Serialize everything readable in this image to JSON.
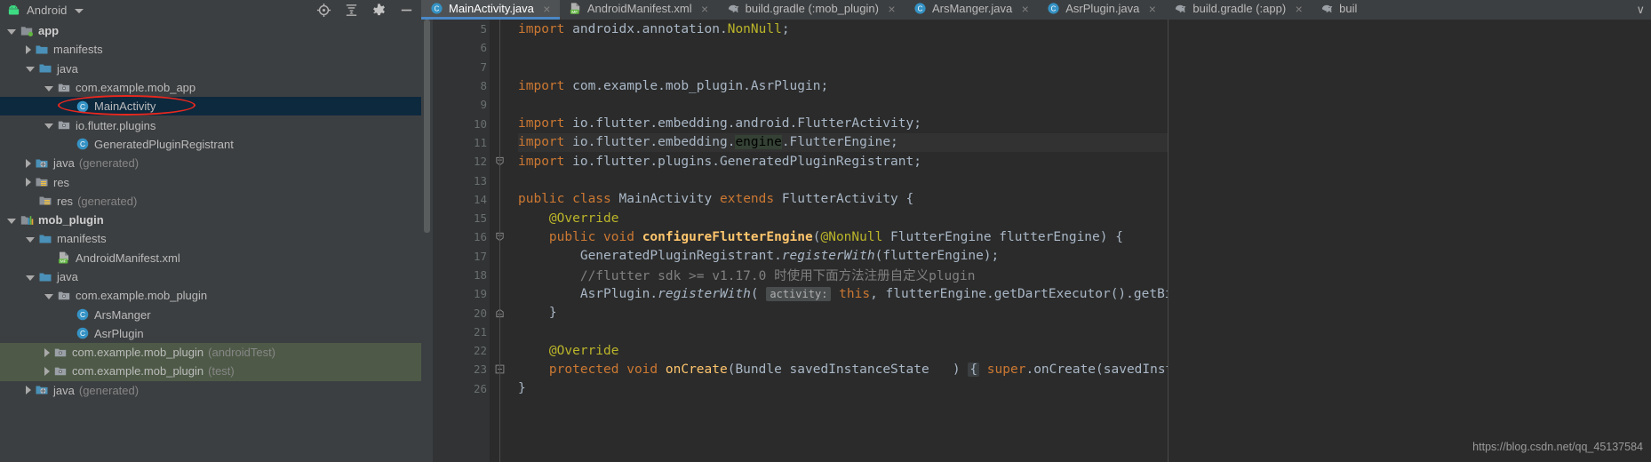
{
  "window": {
    "project_panel_title": "Android",
    "panel_icons": [
      "target-icon",
      "collapse-all-icon",
      "settings-gear-icon",
      "minimize-icon"
    ]
  },
  "tabs": {
    "overflow_label": "∨",
    "items": [
      {
        "label": "MainActivity.java",
        "icon": "java-class-icon",
        "active": true,
        "close": "×"
      },
      {
        "label": "AndroidManifest.xml",
        "icon": "manifest-xml-icon",
        "active": false,
        "close": "×"
      },
      {
        "label": "build.gradle (:mob_plugin)",
        "icon": "gradle-elephant-icon",
        "active": false,
        "close": "×"
      },
      {
        "label": "ArsManger.java",
        "icon": "java-class-icon",
        "active": false,
        "close": "×"
      },
      {
        "label": "AsrPlugin.java",
        "icon": "java-class-icon",
        "active": false,
        "close": "×"
      },
      {
        "label": "build.gradle (:app)",
        "icon": "gradle-elephant-icon",
        "active": false,
        "close": "×"
      },
      {
        "label": "buil",
        "icon": "gradle-elephant-icon",
        "active": false,
        "close": ""
      }
    ]
  },
  "project_tree": {
    "rows": [
      {
        "indent": 0,
        "arrow": "down",
        "icon": "module-app-icon",
        "label": "app",
        "suffix": "",
        "bold": true,
        "state": "normal"
      },
      {
        "indent": 1,
        "arrow": "right",
        "icon": "folder-icon",
        "label": "manifests",
        "suffix": "",
        "bold": false,
        "state": "normal"
      },
      {
        "indent": 1,
        "arrow": "down",
        "icon": "folder-icon",
        "label": "java",
        "suffix": "",
        "bold": false,
        "state": "normal"
      },
      {
        "indent": 2,
        "arrow": "down",
        "icon": "package-icon",
        "label": "com.example.mob_app",
        "suffix": "",
        "bold": false,
        "state": "normal"
      },
      {
        "indent": 3,
        "arrow": "none",
        "icon": "java-class-icon",
        "label": "MainActivity",
        "suffix": "",
        "bold": false,
        "state": "selected"
      },
      {
        "indent": 2,
        "arrow": "down",
        "icon": "package-icon",
        "label": "io.flutter.plugins",
        "suffix": "",
        "bold": false,
        "state": "normal"
      },
      {
        "indent": 3,
        "arrow": "none",
        "icon": "java-class-icon",
        "label": "GeneratedPluginRegistrant",
        "suffix": "",
        "bold": false,
        "state": "normal"
      },
      {
        "indent": 1,
        "arrow": "right",
        "icon": "folder-generated-icon",
        "label": "java",
        "suffix": "(generated)",
        "bold": false,
        "state": "normal"
      },
      {
        "indent": 1,
        "arrow": "right",
        "icon": "res-folder-icon",
        "label": "res",
        "suffix": "",
        "bold": false,
        "state": "normal"
      },
      {
        "indent": 1,
        "arrow": "none",
        "icon": "res-folder-icon",
        "label": "res",
        "suffix": "(generated)",
        "bold": false,
        "state": "normal"
      },
      {
        "indent": 0,
        "arrow": "down",
        "icon": "module-library-icon",
        "label": "mob_plugin",
        "suffix": "",
        "bold": true,
        "state": "normal"
      },
      {
        "indent": 1,
        "arrow": "down",
        "icon": "folder-icon",
        "label": "manifests",
        "suffix": "",
        "bold": false,
        "state": "normal"
      },
      {
        "indent": 2,
        "arrow": "none",
        "icon": "manifest-xml-icon",
        "label": "AndroidManifest.xml",
        "suffix": "",
        "bold": false,
        "state": "normal"
      },
      {
        "indent": 1,
        "arrow": "down",
        "icon": "folder-icon",
        "label": "java",
        "suffix": "",
        "bold": false,
        "state": "normal"
      },
      {
        "indent": 2,
        "arrow": "down",
        "icon": "package-icon",
        "label": "com.example.mob_plugin",
        "suffix": "",
        "bold": false,
        "state": "normal"
      },
      {
        "indent": 3,
        "arrow": "none",
        "icon": "java-class-icon",
        "label": "ArsManger",
        "suffix": "",
        "bold": false,
        "state": "normal"
      },
      {
        "indent": 3,
        "arrow": "none",
        "icon": "java-class-icon",
        "label": "AsrPlugin",
        "suffix": "",
        "bold": false,
        "state": "normal"
      },
      {
        "indent": 2,
        "arrow": "right",
        "icon": "package-icon",
        "label": "com.example.mob_plugin",
        "suffix": "(androidTest)",
        "bold": false,
        "state": "green"
      },
      {
        "indent": 2,
        "arrow": "right",
        "icon": "package-icon",
        "label": "com.example.mob_plugin",
        "suffix": "(test)",
        "bold": false,
        "state": "green"
      },
      {
        "indent": 1,
        "arrow": "right",
        "icon": "folder-generated-icon",
        "label": "java",
        "suffix": "(generated)",
        "bold": false,
        "state": "normal"
      }
    ]
  },
  "editor": {
    "line_numbers": [
      "5",
      "6",
      "7",
      "8",
      "9",
      "10",
      "11",
      "12",
      "13",
      "14",
      "15",
      "16",
      "17",
      "18",
      "19",
      "20",
      "21",
      "22",
      "23",
      "26"
    ],
    "lines": [
      {
        "n": "5",
        "indent": 0,
        "tokens": [
          {
            "t": "import ",
            "c": "kw"
          },
          {
            "t": "androidx.annotation.",
            "c": "txt"
          },
          {
            "t": "NonNull",
            "c": "ann"
          },
          {
            "t": ";",
            "c": "sc"
          }
        ]
      },
      {
        "n": "6",
        "indent": 0,
        "tokens": []
      },
      {
        "n": "7",
        "indent": 0,
        "tokens": []
      },
      {
        "n": "8",
        "indent": 0,
        "tokens": [
          {
            "t": "import ",
            "c": "kw"
          },
          {
            "t": "com.example.mob_plugin.AsrPlugin;",
            "c": "txt"
          }
        ]
      },
      {
        "n": "9",
        "indent": 0,
        "tokens": []
      },
      {
        "n": "10",
        "indent": 0,
        "tokens": [
          {
            "t": "import ",
            "c": "kw"
          },
          {
            "t": "io.flutter.embedding.android.FlutterActivity;",
            "c": "txt"
          }
        ]
      },
      {
        "n": "11",
        "indent": 0,
        "highlight": true,
        "tokens": [
          {
            "t": "import ",
            "c": "kw"
          },
          {
            "t": "io.flutter.embedding.",
            "c": "txt"
          },
          {
            "t": "engine",
            "c": "hlword"
          },
          {
            "t": ".FlutterEngine;",
            "c": "txt"
          }
        ]
      },
      {
        "n": "12",
        "indent": 0,
        "tokens": [
          {
            "t": "import ",
            "c": "kw"
          },
          {
            "t": "io.flutter.plugins.GeneratedPluginRegistrant;",
            "c": "txt"
          }
        ]
      },
      {
        "n": "13",
        "indent": 0,
        "tokens": []
      },
      {
        "n": "14",
        "indent": 0,
        "tokens": [
          {
            "t": "public class ",
            "c": "kw"
          },
          {
            "t": "MainActivity ",
            "c": "txt"
          },
          {
            "t": "extends ",
            "c": "kw"
          },
          {
            "t": "FlutterActivity {",
            "c": "txt"
          }
        ]
      },
      {
        "n": "15",
        "indent": 1,
        "tokens": [
          {
            "t": "@Override",
            "c": "ann"
          }
        ]
      },
      {
        "n": "16",
        "indent": 1,
        "tokens": [
          {
            "t": "public void ",
            "c": "kw"
          },
          {
            "t": "configureFlutterEngine",
            "c": "mth-b"
          },
          {
            "t": "(",
            "c": "txt"
          },
          {
            "t": "@NonNull",
            "c": "ann"
          },
          {
            "t": " FlutterEngine flutterEngine) {",
            "c": "txt"
          }
        ]
      },
      {
        "n": "17",
        "indent": 2,
        "tokens": [
          {
            "t": "GeneratedPluginRegistrant.",
            "c": "txt"
          },
          {
            "t": "registerWith",
            "c": "mth-i"
          },
          {
            "t": "(flutterEngine)",
            "c": "txt"
          },
          {
            "t": ";",
            "c": "sc"
          }
        ]
      },
      {
        "n": "18",
        "indent": 2,
        "tokens": [
          {
            "t": "//flutter sdk >= v1.17.0 时使用下面方法注册自定义plugin",
            "c": "cmt"
          }
        ]
      },
      {
        "n": "19",
        "indent": 2,
        "tokens": [
          {
            "t": "AsrPlugin.",
            "c": "txt"
          },
          {
            "t": "registerWith",
            "c": "mth-i"
          },
          {
            "t": "( ",
            "c": "txt"
          },
          {
            "t": "activity:",
            "c": "hint"
          },
          {
            "t": " ",
            "c": "txt"
          },
          {
            "t": "this",
            "c": "kw"
          },
          {
            "t": ", flutterEngine.getDartExecutor().getBinaryMessenger());",
            "c": "txt"
          }
        ]
      },
      {
        "n": "20",
        "indent": 1,
        "tokens": [
          {
            "t": "}",
            "c": "txt"
          }
        ]
      },
      {
        "n": "21",
        "indent": 0,
        "tokens": []
      },
      {
        "n": "22",
        "indent": 1,
        "tokens": [
          {
            "t": "@Override",
            "c": "ann"
          }
        ]
      },
      {
        "n": "23",
        "indent": 1,
        "tokens": [
          {
            "t": "protected void ",
            "c": "kw"
          },
          {
            "t": "onCreate",
            "c": "mth"
          },
          {
            "t": "(Bundle savedInstanceState   ) ",
            "c": "txt"
          },
          {
            "t": "{",
            "c": "fold"
          },
          {
            "t": " super",
            "c": "kw"
          },
          {
            "t": ".onCreate(savedInstanceState)",
            "c": "txt"
          },
          {
            "t": ";",
            "c": "sc"
          },
          {
            "t": " }",
            "c": "txt"
          }
        ]
      },
      {
        "n": "26",
        "indent": 0,
        "tokens": [
          {
            "t": "}",
            "c": "txt"
          }
        ]
      }
    ],
    "gutter_marks": [
      {
        "line": "14",
        "icon": "manifest-class-gutter-icon"
      },
      {
        "line": "16",
        "icon": "override-method-gutter-icon"
      },
      {
        "line": "23",
        "icon": "override-method-gutter-icon"
      }
    ],
    "fold_marks": [
      {
        "line": "12",
        "type": "fold-top"
      },
      {
        "line": "16",
        "type": "fold-open"
      },
      {
        "line": "20",
        "type": "fold-bottom"
      },
      {
        "line": "23",
        "type": "fold-collapsed"
      }
    ]
  },
  "watermark": {
    "text": "https://blog.csdn.net/qq_45137584"
  },
  "colors": {
    "panel_bg": "#3c3f41",
    "editor_bg": "#2b2b2b",
    "gutter_bg": "#313335",
    "selection_blue": "#0d293e",
    "test_green": "#4e5a47",
    "tab_active": "#4e5254",
    "tab_underline": "#4a88c7",
    "annotation_red": "#e8281e",
    "keyword_orange": "#cc7832",
    "text_grey": "#a9b7c6",
    "annotation_yellow": "#bbb529",
    "method_yellow": "#ffc66d",
    "comment_grey": "#808080"
  }
}
